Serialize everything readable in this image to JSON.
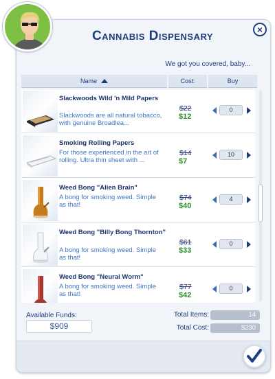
{
  "window": {
    "title": "Cannabis Dispensary",
    "subtitle": "We got you covered, baby..."
  },
  "columns": {
    "name": "Name",
    "cost": "Cost:",
    "buy": "Buy"
  },
  "items": [
    {
      "name": "Slackwoods Wild 'n Mild Papers",
      "description": "Slackwoods are all natural tobacco, with genuine Broadlea...",
      "old_price": "$22",
      "new_price": "$12",
      "quantity": "0",
      "icon": "rolling-papers-box-icon"
    },
    {
      "name": "Smoking Rolling Papers",
      "description": "For those experienced in the art of rolling. Ultra thin sheet with ...",
      "old_price": "$14",
      "new_price": "$7",
      "quantity": "10",
      "icon": "rolling-papers-pack-icon"
    },
    {
      "name": "Weed Bong \"Alien Brain\"",
      "description": "A bong for smoking weed. Simple as that!",
      "old_price": "$74",
      "new_price": "$40",
      "quantity": "4",
      "icon": "amber-bong-icon"
    },
    {
      "name": "Weed Bong \"Billy Bong Thornton\"",
      "description": "A bong for smoking weed. Simple as that!",
      "old_price": "$61",
      "new_price": "$33",
      "quantity": "0",
      "icon": "white-bong-icon"
    },
    {
      "name": "Weed Bong \"Neural Worm\"",
      "description": "A bong for smoking weed. Simple as that!",
      "old_price": "$77",
      "new_price": "$42",
      "quantity": "0",
      "icon": "red-bong-icon"
    }
  ],
  "footer": {
    "funds_label": "Available Funds:",
    "funds_value": "$909",
    "total_items_label": "Total Items:",
    "total_items_value": "14",
    "total_cost_label": "Total Cost:",
    "total_cost_value": "$230"
  },
  "colors": {
    "accent": "#1e3d7c",
    "link_blue": "#3e74c4",
    "sale_green": "#2f8c2f",
    "avatar_bg": "#7ec044"
  }
}
